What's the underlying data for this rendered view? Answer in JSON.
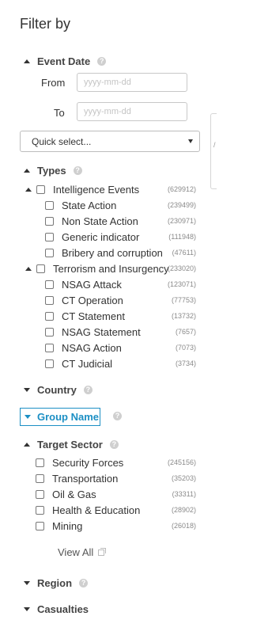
{
  "title": "Filter by",
  "event_date": {
    "label": "Event Date",
    "from_label": "From",
    "to_label": "To",
    "from_placeholder": "yyyy-mm-dd",
    "to_placeholder": "yyyy-mm-dd",
    "quick_select": "Quick select..."
  },
  "types": {
    "label": "Types",
    "groups": [
      {
        "label": "Intelligence Events",
        "count": "(629912)",
        "items": [
          {
            "label": "State Action",
            "count": "(239499)"
          },
          {
            "label": "Non State Action",
            "count": "(230971)"
          },
          {
            "label": "Generic indicator",
            "count": "(111948)"
          },
          {
            "label": "Bribery and corruption",
            "count": "(47611)"
          }
        ]
      },
      {
        "label": "Terrorism and Insurgency",
        "count": "(233020)",
        "items": [
          {
            "label": "NSAG Attack",
            "count": "(123071)"
          },
          {
            "label": "CT Operation",
            "count": "(77753)"
          },
          {
            "label": "CT Statement",
            "count": "(13732)"
          },
          {
            "label": "NSAG Statement",
            "count": "(7657)"
          },
          {
            "label": "NSAG Action",
            "count": "(7073)"
          },
          {
            "label": "CT Judicial",
            "count": "(3734)"
          }
        ]
      }
    ]
  },
  "country": {
    "label": "Country"
  },
  "group_name": {
    "label": "Group Name"
  },
  "target_sector": {
    "label": "Target Sector",
    "items": [
      {
        "label": "Security Forces",
        "count": "(245156)"
      },
      {
        "label": "Transportation",
        "count": "(35203)"
      },
      {
        "label": "Oil & Gas",
        "count": "(33311)"
      },
      {
        "label": "Health & Education",
        "count": "(28902)"
      },
      {
        "label": "Mining",
        "count": "(26018)"
      }
    ],
    "view_all": "View All"
  },
  "region": {
    "label": "Region"
  },
  "casualties": {
    "label": "Casualties"
  },
  "side_glyph": "/"
}
